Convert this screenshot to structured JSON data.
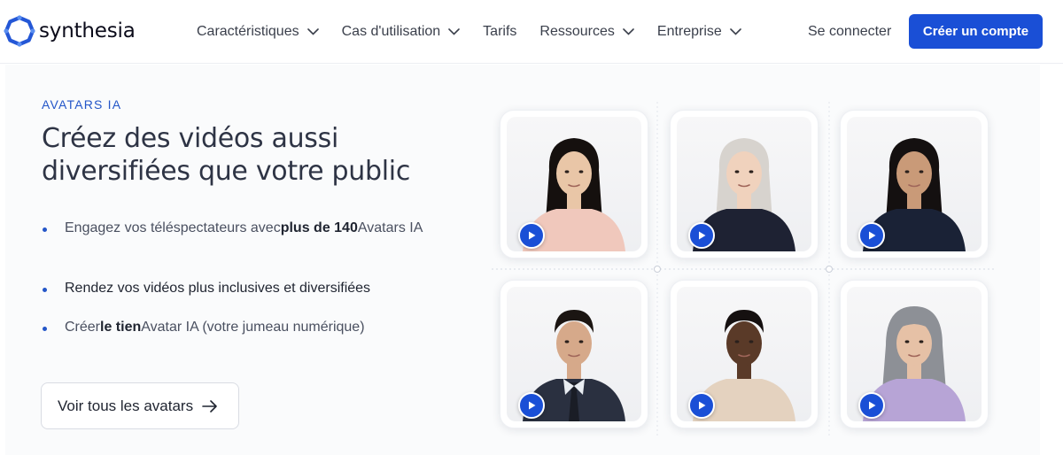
{
  "brand": {
    "name": "synthesia",
    "accent": "#1a4fd6"
  },
  "nav": {
    "items": [
      {
        "label": "Caractéristiques",
        "dropdown": true
      },
      {
        "label": "Cas d'utilisation",
        "dropdown": true
      },
      {
        "label": "Tarifs",
        "dropdown": false
      },
      {
        "label": "Ressources",
        "dropdown": true
      },
      {
        "label": "Entreprise",
        "dropdown": true
      }
    ],
    "signin": "Se connecter",
    "cta": "Créer un compte"
  },
  "hero": {
    "eyebrow": "AVATARS IA",
    "heading": "Créez des vidéos aussi diversifiées que votre public",
    "bullets": [
      {
        "before": "Engagez vos téléspectateurs avec",
        "strong": "plus de 140",
        "after": "Avatars IA"
      },
      {
        "before": "",
        "strong": "",
        "after": "Rendez vos vidéos plus inclusives et diversifiées"
      },
      {
        "before": "Créer",
        "strong": "le tien",
        "after": "Avatar IA (votre jumeau numérique)"
      }
    ],
    "button": "Voir tous les avatars"
  },
  "avatars": [
    {
      "icon": "avatar-woman-long-hair",
      "skin": "#e9c6a7",
      "hair": "#15100e",
      "top": "#f0c8bc"
    },
    {
      "icon": "avatar-woman-grey-hair",
      "skin": "#f0d2bd",
      "hair": "#d7d3ce",
      "top": "#1e2233"
    },
    {
      "icon": "avatar-woman-dark-hair",
      "skin": "#c99a78",
      "hair": "#141010",
      "top": "#1a2236"
    },
    {
      "icon": "avatar-man-suit",
      "skin": "#d6a98a",
      "hair": "#1b1512",
      "top": "#2a3040"
    },
    {
      "icon": "avatar-man-casual",
      "skin": "#5a3a28",
      "hair": "#151010",
      "top": "#e4d2bf"
    },
    {
      "icon": "avatar-woman-hijab",
      "skin": "#e6c1a6",
      "hair": "#8d9096",
      "top": "#b7a4d6"
    }
  ]
}
